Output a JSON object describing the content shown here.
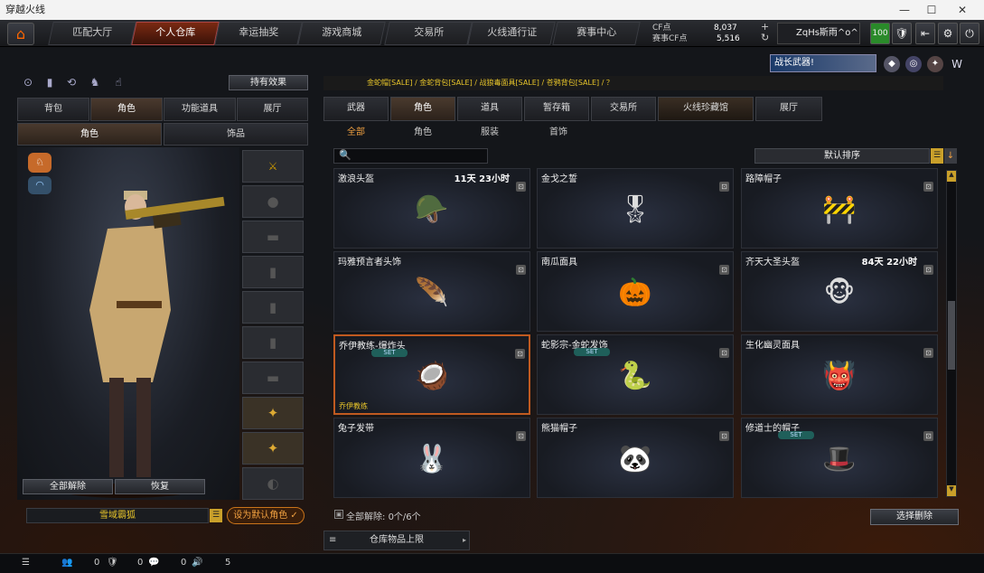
{
  "window": {
    "title": "穿越火线"
  },
  "nav": {
    "items": [
      "匹配大厅",
      "个人仓库",
      "幸运抽奖",
      "游戏商城",
      "交易所",
      "火线通行证",
      "赛事中心"
    ],
    "active": 1
  },
  "currency": {
    "cf_label": "CF点",
    "cf_value": "8,037",
    "match_label": "赛事CF点",
    "match_value": "5,516"
  },
  "user": {
    "name": "ZqHs斯雨^o^",
    "level": "100"
  },
  "promo": {
    "banner": "战长武器!"
  },
  "left": {
    "effect_button": "持有效果",
    "tabs": [
      "背包",
      "角色",
      "功能道具",
      "展厅"
    ],
    "subtabs": [
      "角色",
      "饰品"
    ],
    "unequip_all": "全部解除",
    "restore": "恢复",
    "char_name": "雪域霸狐",
    "set_default": "设为默认角色"
  },
  "marquee": "金蛇帽[SALE] / 金蛇背包[SALE] / 战狼毒面具[SALE] / 苍鸦背包[SALE] / ？",
  "tabs": [
    "武器",
    "角色",
    "道具",
    "暂存箱",
    "交易所",
    "火线珍藏馆",
    "展厅"
  ],
  "subtabs": [
    "全部",
    "角色",
    "服装",
    "首饰"
  ],
  "sort": {
    "label": "默认排序"
  },
  "items": [
    {
      "name": "激浪头盔",
      "time": "11天 23小时",
      "icon": "🪖"
    },
    {
      "name": "金戈之誓",
      "time": "",
      "icon": "🎖"
    },
    {
      "name": "路障帽子",
      "time": "",
      "icon": "🚧"
    },
    {
      "name": "玛雅预言者头饰",
      "time": "",
      "icon": "🪶"
    },
    {
      "name": "南瓜面具",
      "time": "",
      "icon": "🎃"
    },
    {
      "name": "齐天大圣头盔",
      "time": "84天 22小时",
      "icon": "🐵"
    },
    {
      "name": "乔伊教练-爆炸头",
      "time": "",
      "icon": "🥥",
      "set": "SET",
      "tag": "乔伊教练"
    },
    {
      "name": "蛇影宗-金蛇发饰",
      "time": "",
      "icon": "🐍",
      "set": "SET"
    },
    {
      "name": "生化幽灵面具",
      "time": "",
      "icon": "👹"
    },
    {
      "name": "兔子发带",
      "time": "",
      "icon": "🐰"
    },
    {
      "name": "熊猫帽子",
      "time": "",
      "icon": "🐼"
    },
    {
      "name": "修道士的帽子",
      "time": "",
      "icon": "🎩",
      "set": "SET"
    }
  ],
  "bottom": {
    "unequip_label": "全部解除:",
    "unequip_count": "0个/6个",
    "select_delete": "选择删除",
    "storage_limit": "仓库物品上限"
  },
  "status": {
    "friends": "0",
    "guild": "0",
    "msg": "0",
    "voice": "5"
  }
}
